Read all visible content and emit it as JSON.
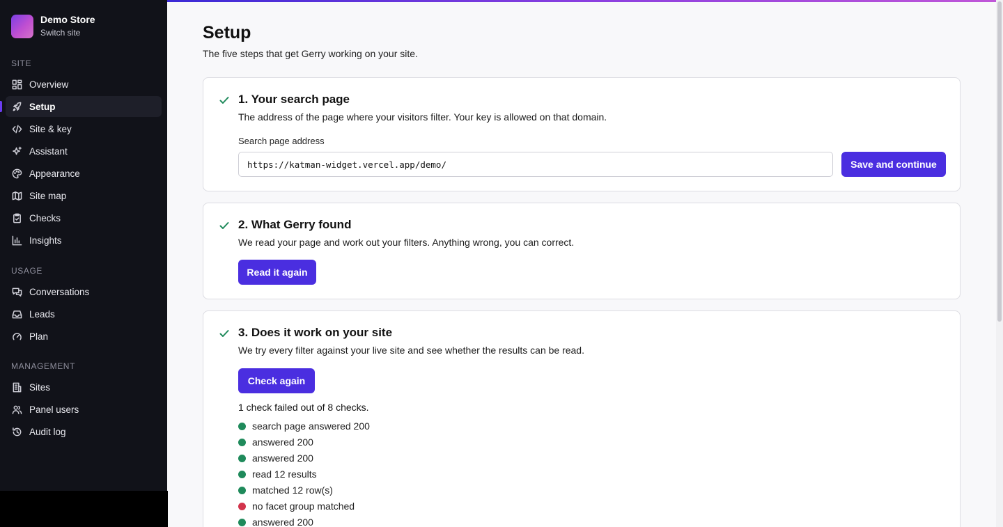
{
  "store": {
    "name": "Demo Store",
    "switch_label": "Switch site"
  },
  "sidebar": {
    "sections": [
      {
        "label": "SITE",
        "items": [
          {
            "label": "Overview",
            "icon": "grid-icon"
          },
          {
            "label": "Setup",
            "icon": "rocket-icon",
            "active": true
          },
          {
            "label": "Site & key",
            "icon": "code-icon"
          },
          {
            "label": "Assistant",
            "icon": "sparkles-icon"
          },
          {
            "label": "Appearance",
            "icon": "palette-icon"
          },
          {
            "label": "Site map",
            "icon": "map-icon"
          },
          {
            "label": "Checks",
            "icon": "clipboard-check-icon"
          },
          {
            "label": "Insights",
            "icon": "bar-chart-icon"
          }
        ]
      },
      {
        "label": "USAGE",
        "items": [
          {
            "label": "Conversations",
            "icon": "messages-icon"
          },
          {
            "label": "Leads",
            "icon": "inbox-icon"
          },
          {
            "label": "Plan",
            "icon": "gauge-icon"
          }
        ]
      },
      {
        "label": "MANAGEMENT",
        "items": [
          {
            "label": "Sites",
            "icon": "building-icon"
          },
          {
            "label": "Panel users",
            "icon": "users-icon"
          },
          {
            "label": "Audit log",
            "icon": "history-icon"
          }
        ]
      }
    ]
  },
  "page": {
    "title": "Setup",
    "subtitle": "The five steps that get Gerry working on your site."
  },
  "steps": [
    {
      "title": "1. Your search page",
      "description": "The address of the page where your visitors filter. Your key is allowed on that domain.",
      "field_label": "Search page address",
      "field_value": "https://katman-widget.vercel.app/demo/",
      "button": "Save and continue",
      "done": true
    },
    {
      "title": "2. What Gerry found",
      "description": "We read your page and work out your filters. Anything wrong, you can correct.",
      "button": "Read it again",
      "done": true
    },
    {
      "title": "3. Does it work on your site",
      "description": "We try every filter against your live site and see whether the results can be read.",
      "button": "Check again",
      "summary": "1 check failed out of 8 checks.",
      "results": [
        {
          "text": "search page answered 200",
          "status": "ok"
        },
        {
          "text": "answered 200",
          "status": "ok"
        },
        {
          "text": "answered 200",
          "status": "ok"
        },
        {
          "text": "read 12 results",
          "status": "ok"
        },
        {
          "text": "matched 12 row(s)",
          "status": "ok"
        },
        {
          "text": "no facet group matched",
          "status": "fail"
        },
        {
          "text": "answered 200",
          "status": "ok"
        }
      ],
      "done": true
    }
  ],
  "colors": {
    "accent": "#4a2ee0",
    "ok": "#1f8a5b",
    "fail": "#d2344c",
    "sidebar_bg": "#111219"
  }
}
